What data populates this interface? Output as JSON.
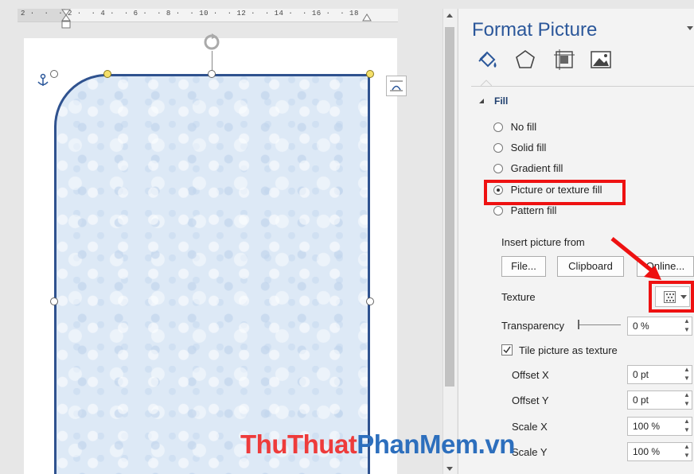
{
  "ruler": {
    "text": "2 ·  ·  · 2 ·  · 4 ·  · 6 ·  · 8 ·  · 10 ·  · 12 ·  · 14 ·  · 16 ·  · 18"
  },
  "panel": {
    "title": "Format Picture",
    "tabs": [
      {
        "name": "fill-line-tab",
        "icon": "paint-bucket-icon"
      },
      {
        "name": "effects-tab",
        "icon": "pentagon-icon"
      },
      {
        "name": "layout-properties-tab",
        "icon": "size-properties-icon"
      },
      {
        "name": "picture-tab",
        "icon": "picture-icon"
      }
    ],
    "section": "Fill",
    "fill_options": [
      {
        "label": "No fill",
        "selected": false
      },
      {
        "label": "Solid fill",
        "selected": false
      },
      {
        "label": "Gradient fill",
        "selected": false
      },
      {
        "label": "Picture or texture fill",
        "selected": true
      },
      {
        "label": "Pattern fill",
        "selected": false
      }
    ],
    "insert_from_label": "Insert picture from",
    "buttons": {
      "file": "File...",
      "clipboard": "Clipboard",
      "online": "Online..."
    },
    "texture_label": "Texture",
    "transparency_label": "Transparency",
    "transparency_value": "0 %",
    "tile_label": "Tile picture as texture",
    "tile_checked": true,
    "offset_x_label": "Offset X",
    "offset_x_value": "0 pt",
    "offset_y_label": "Offset Y",
    "offset_y_value": "0 pt",
    "scale_x_label": "Scale X",
    "scale_x_value": "100 %",
    "scale_y_label": "Scale Y",
    "scale_y_value": "100 %"
  },
  "watermark": {
    "part1": "ThuThuat",
    "part2": "PhanMem",
    "part3": ".vn"
  },
  "colors": {
    "accent": "#2b579a",
    "highlight": "#ee1111",
    "shape_border": "#2f528f"
  }
}
